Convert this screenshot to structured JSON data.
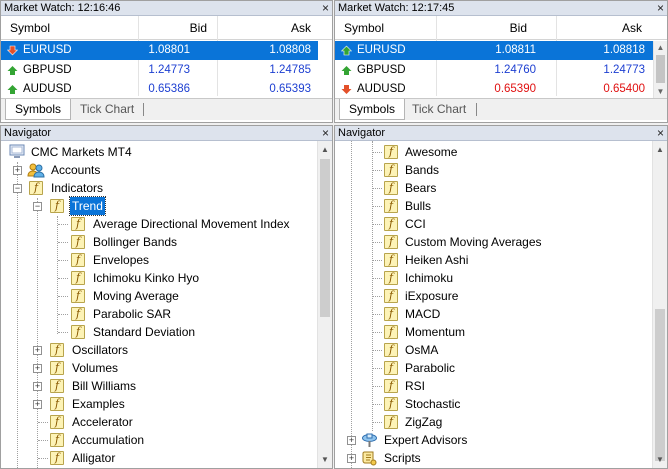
{
  "market_watch_left": {
    "title": "Market Watch: 12:16:46",
    "close_glyph": "×",
    "columns": {
      "symbol": "Symbol",
      "bid": "Bid",
      "ask": "Ask"
    },
    "rows": [
      {
        "symbol": "EURUSD",
        "bid": "1.08801",
        "ask": "1.08808",
        "direction": "down"
      },
      {
        "symbol": "GBPUSD",
        "bid": "1.24773",
        "ask": "1.24785",
        "direction": "up"
      },
      {
        "symbol": "AUDUSD",
        "bid": "0.65386",
        "ask": "0.65393",
        "direction": "up"
      }
    ],
    "tabs": [
      "Symbols",
      "Tick Chart"
    ]
  },
  "market_watch_right": {
    "title": "Market Watch: 12:17:45",
    "close_glyph": "×",
    "columns": {
      "symbol": "Symbol",
      "bid": "Bid",
      "ask": "Ask"
    },
    "rows": [
      {
        "symbol": "EURUSD",
        "bid": "1.08811",
        "ask": "1.08818",
        "direction": "up"
      },
      {
        "symbol": "GBPUSD",
        "bid": "1.24760",
        "ask": "1.24773",
        "direction": "up"
      },
      {
        "symbol": "AUDUSD",
        "bid": "0.65390",
        "ask": "0.65400",
        "direction": "down"
      }
    ],
    "tabs": [
      "Symbols",
      "Tick Chart"
    ]
  },
  "navigator_left": {
    "title": "Navigator",
    "close_glyph": "×",
    "root": "CMC Markets MT4",
    "accounts": "Accounts",
    "indicators": "Indicators",
    "trend": "Trend",
    "trend_items": [
      "Average Directional Movement Index",
      "Bollinger Bands",
      "Envelopes",
      "Ichimoku Kinko Hyo",
      "Moving Average",
      "Parabolic SAR",
      "Standard Deviation"
    ],
    "folders": [
      "Oscillators",
      "Volumes",
      "Bill Williams",
      "Examples"
    ],
    "indicator_items": [
      "Accelerator",
      "Accumulation",
      "Alligator"
    ]
  },
  "navigator_right": {
    "title": "Navigator",
    "close_glyph": "×",
    "items": [
      "Awesome",
      "Bands",
      "Bears",
      "Bulls",
      "CCI",
      "Custom Moving Averages",
      "Heiken Ashi",
      "Ichimoku",
      "iExposure",
      "MACD",
      "Momentum",
      "OsMA",
      "Parabolic",
      "RSI",
      "Stochastic",
      "ZigZag"
    ],
    "expert_advisors": "Expert Advisors",
    "scripts": "Scripts"
  },
  "colors": {
    "selection": "#0a74d8",
    "bid_ask": "#1d3fd1",
    "price_down": "#e01010",
    "title_bar": "#dde3ed"
  }
}
